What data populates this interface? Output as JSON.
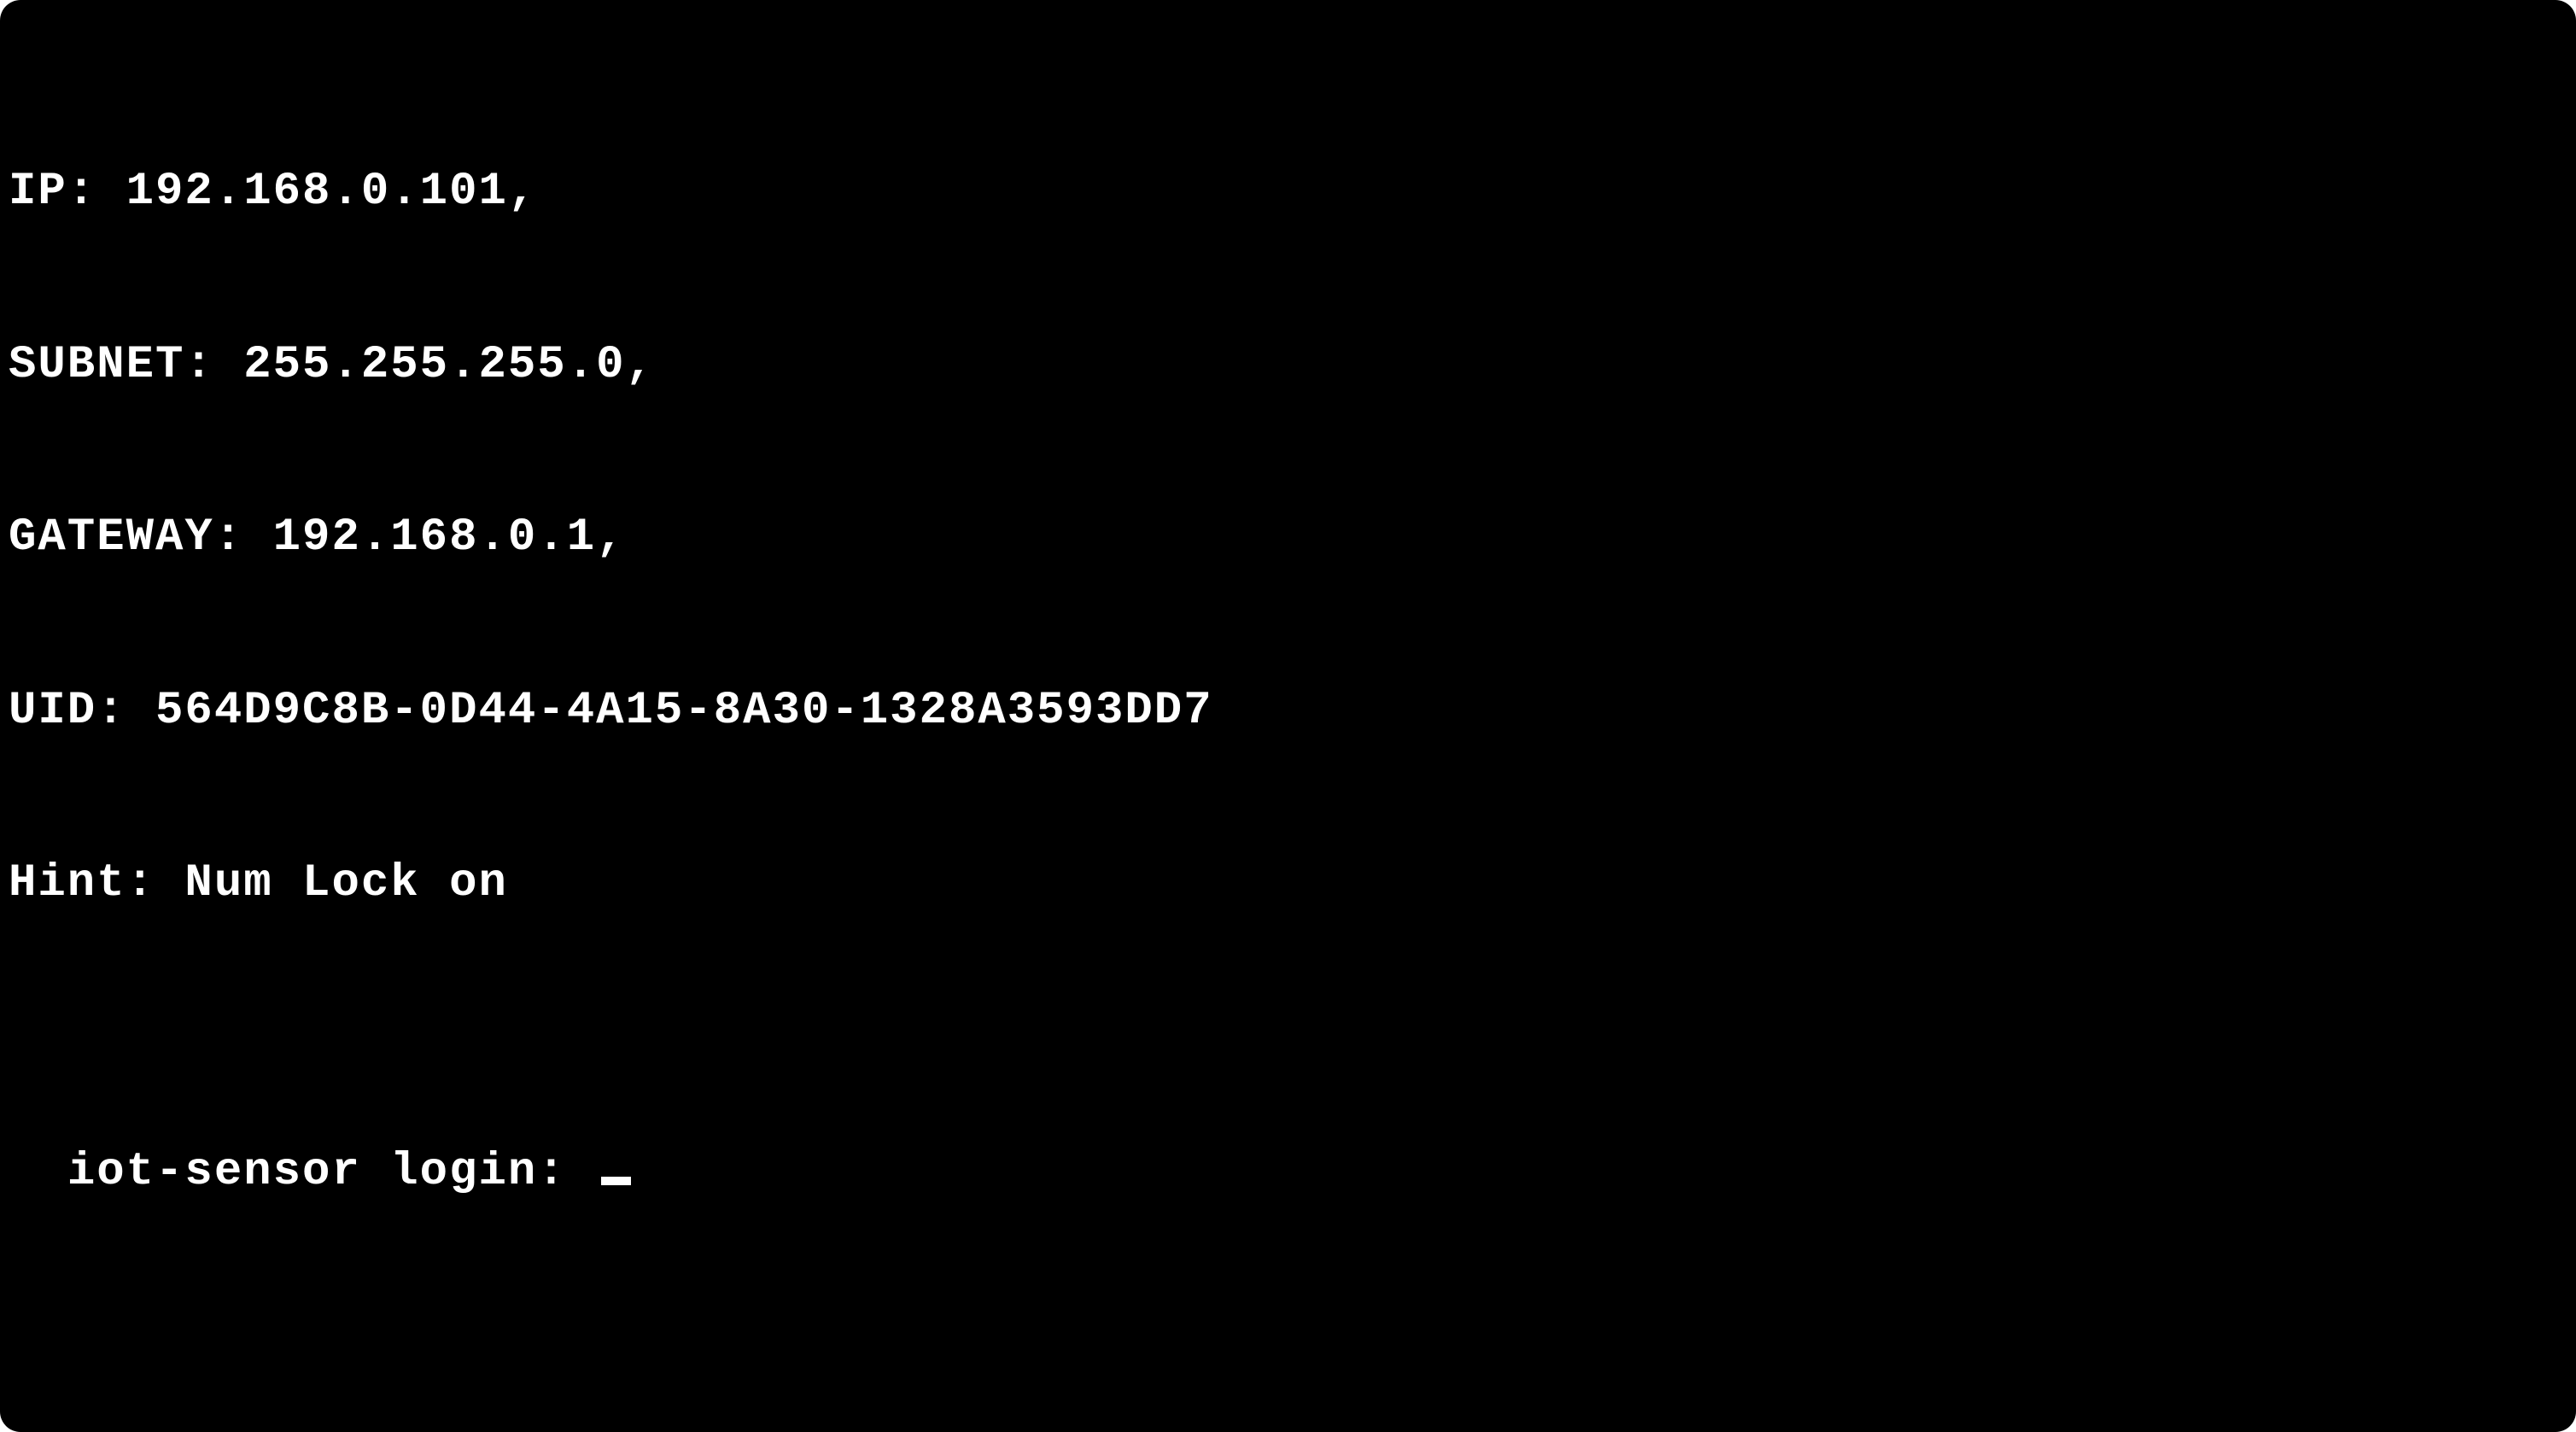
{
  "terminal": {
    "lines": {
      "ip": "IP: 192.168.0.101,",
      "subnet": "SUBNET: 255.255.255.0,",
      "gateway": "GATEWAY: 192.168.0.1,",
      "uid": "UID: 564D9C8B-0D44-4A15-8A30-1328A3593DD7",
      "hint": "Hint: Num Lock on"
    },
    "login_prompt": "iot-sensor login: "
  }
}
